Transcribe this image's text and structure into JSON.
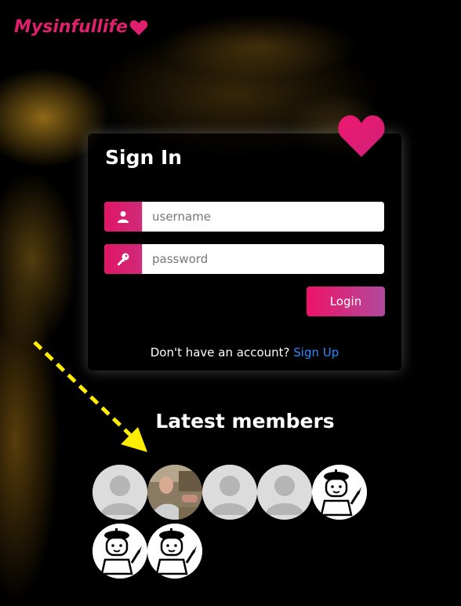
{
  "brand": {
    "name": "Mysinfullife"
  },
  "signin": {
    "title": "Sign In",
    "username_placeholder": "username",
    "password_placeholder": "password",
    "login_label": "Login",
    "no_account_text": "Don't have an account?",
    "signup_label": "Sign Up"
  },
  "latest": {
    "heading": "Latest members",
    "members": [
      {
        "avatar": "default-avatar-icon"
      },
      {
        "avatar": "photo"
      },
      {
        "avatar": "default-avatar-icon"
      },
      {
        "avatar": "default-avatar-icon"
      },
      {
        "avatar": "painter-avatar-icon"
      },
      {
        "avatar": "painter-avatar-icon"
      },
      {
        "avatar": "painter-avatar-icon"
      }
    ]
  },
  "colors": {
    "accent": "#e0206e",
    "link": "#2a8cff",
    "annotation_arrow": "#ffee00"
  }
}
